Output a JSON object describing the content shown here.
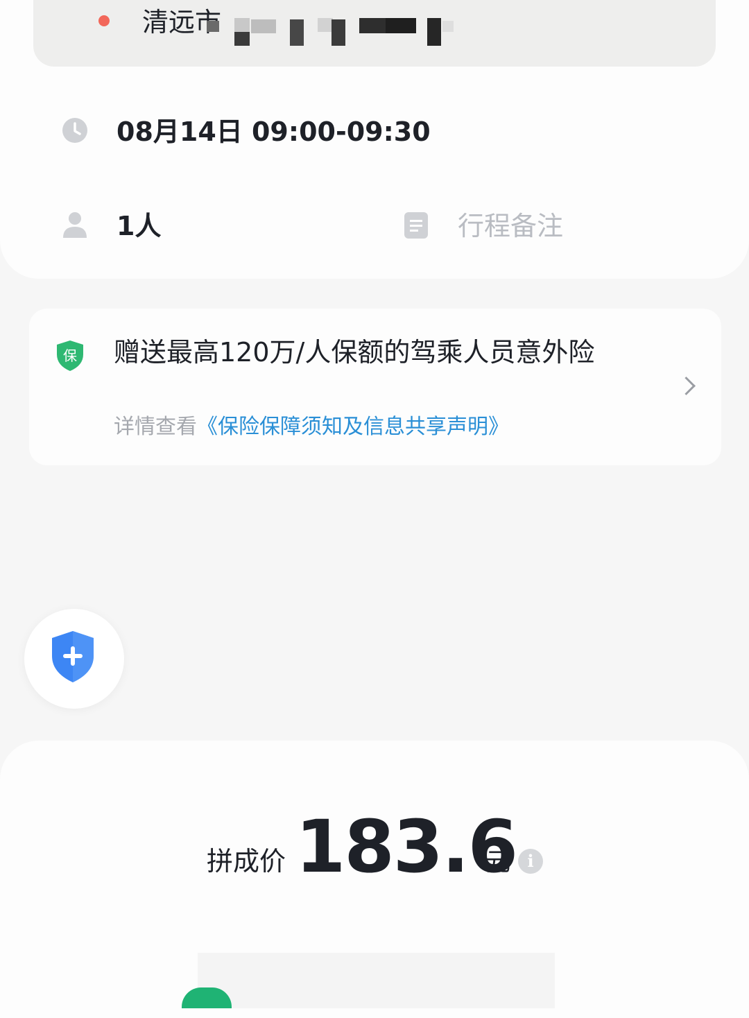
{
  "destination": {
    "city": "清远市"
  },
  "trip": {
    "time": "08月14日 09:00-09:30",
    "passengers": "1人",
    "note_placeholder": "行程备注"
  },
  "insurance": {
    "badge_char": "保",
    "title": "赠送最高120万/人保额的驾乘人员意外险",
    "subtitle_prefix": "详情查看",
    "subtitle_link": "《保险保障须知及信息共享声明》"
  },
  "price": {
    "label": "拼成价",
    "value": "183.6",
    "unit": "元",
    "info_glyph": "i"
  },
  "colors": {
    "accent_blue": "#2a8fd6",
    "shield_green": "#2eb872",
    "fab_blue": "#3d86f4",
    "confirm_green": "#1fb374",
    "dest_dot": "#f2675a"
  },
  "icons": {
    "time": "clock-icon",
    "people": "person-icon",
    "note": "note-icon",
    "insurance": "shield-badge-icon",
    "fab": "shield-plus-icon",
    "detail": "chevron-right-icon",
    "price_info": "info-icon"
  }
}
